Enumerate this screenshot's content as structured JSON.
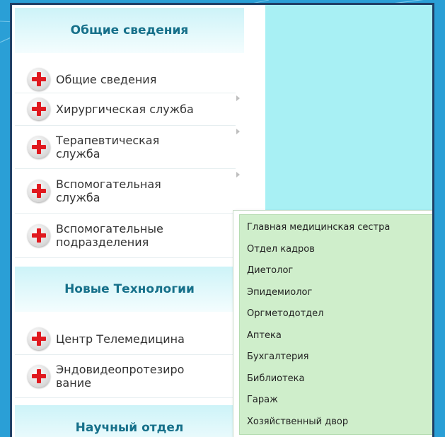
{
  "sections": [
    {
      "title": "Общие сведения",
      "items": [
        {
          "label": "Общие сведения"
        },
        {
          "label": "Хирургическая служба"
        },
        {
          "label": "Терапевтическая служба"
        },
        {
          "label": "Вспомогательная служба"
        },
        {
          "label": "Вспомогательные подразделения"
        }
      ]
    },
    {
      "title": "Новые Технологии",
      "items": [
        {
          "label": "Центр Телемедицина"
        },
        {
          "label": "Эндовидеопротезиро вание"
        }
      ]
    },
    {
      "title": "Научный отдел",
      "items": []
    }
  ],
  "submenu": {
    "items": [
      "Главная медицинская сестра",
      "Отдел кадров",
      "Диетолог",
      "Эпидемиолог",
      "Оргметодотдел",
      "Аптека",
      "Бухгалтерия",
      "Библиотека",
      "Гараж",
      "Хозяйственный двор"
    ]
  },
  "icons": {
    "item_icon": "red-plus-icon",
    "submenu_arrow": "chevron-right-icon"
  },
  "colors": {
    "background": "#2a9fd6",
    "content_area": "#a8f0f4",
    "header_text": "#16708a",
    "submenu_bg": "#cfeecb"
  }
}
